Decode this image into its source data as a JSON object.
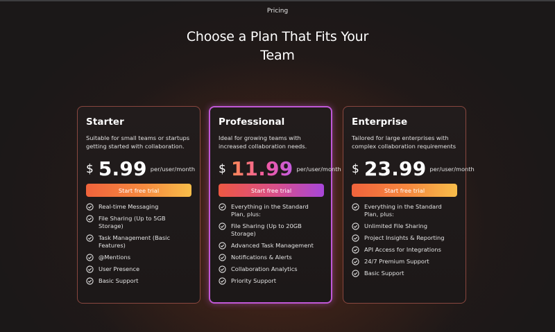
{
  "header": {
    "tag": "Pricing",
    "title": "Choose a Plan That Fits Your Team"
  },
  "colors": {
    "background": "#1b1818",
    "orange_gradient": [
      "#f0633c",
      "#f7bd4a"
    ],
    "purple_gradient": [
      "#ee5843",
      "#a746d9"
    ],
    "pro_border": "#c158d8"
  },
  "plans": [
    {
      "name": "Starter",
      "description": "Suitable for small teams or startups getting started with collaboration.",
      "currency": "$",
      "price": "5.99",
      "period": "per/user/month",
      "cta": "Start free trial",
      "features": [
        "Real-time Messaging",
        "File Sharing (Up to 5GB Storage)",
        "Task Management (Basic Features)",
        "@Mentions",
        "User Presence",
        "Basic Support"
      ]
    },
    {
      "name": "Professional",
      "description": "Ideal for growing teams with increased collaboration needs.",
      "currency": "$",
      "price": "11.99",
      "period": "per/user/month",
      "cta": "Start free trial",
      "features": [
        "Everything in the Standard Plan, plus:",
        "File Sharing (Up to 20GB Storage)",
        "Advanced Task Management",
        "Notifications & Alerts",
        "Collaboration Analytics",
        "Priority Support"
      ]
    },
    {
      "name": "Enterprise",
      "description": "Tailored for large enterprises with complex collaboration requirements",
      "currency": "$",
      "price": "23.99",
      "period": "per/user/month",
      "cta": "Start free trial",
      "features": [
        "Everything in the Standard Plan, plus:",
        "Unlimited File Sharing",
        "Project Insights & Reporting",
        "API Access for Integrations",
        "24/7 Premium Support",
        "Basic Support"
      ]
    }
  ]
}
